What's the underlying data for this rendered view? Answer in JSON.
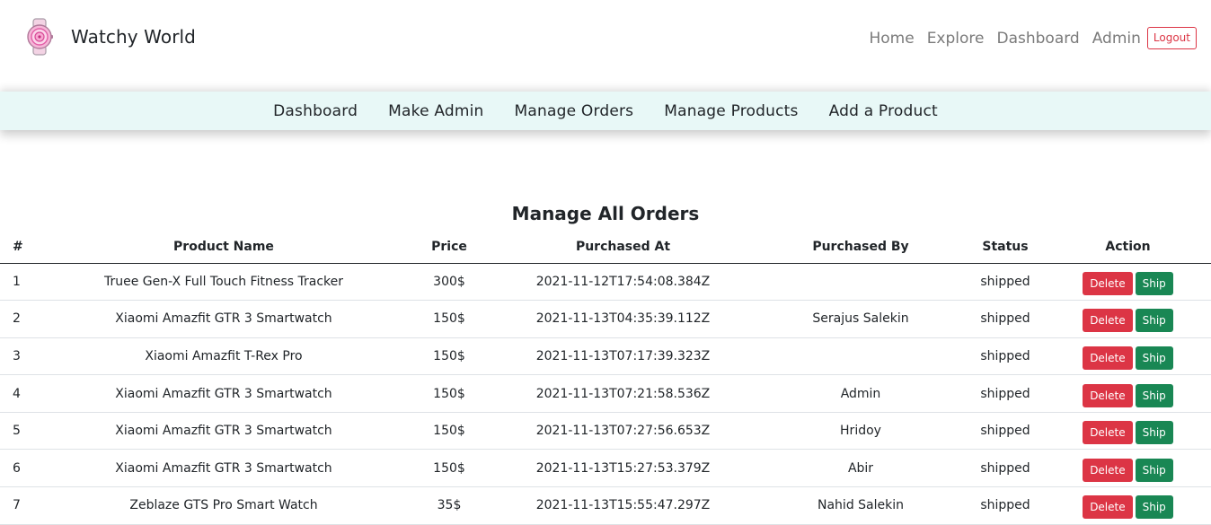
{
  "brand": {
    "name": "Watchy World"
  },
  "topnav": {
    "links": [
      "Home",
      "Explore",
      "Dashboard",
      "Admin"
    ],
    "logout_label": "Logout"
  },
  "subnav": {
    "items": [
      "Dashboard",
      "Make Admin",
      "Manage Orders",
      "Manage Products",
      "Add a Product"
    ]
  },
  "page": {
    "title": "Manage All Orders"
  },
  "table": {
    "headers": [
      "#",
      "Product Name",
      "Price",
      "Purchased At",
      "Purchased By",
      "Status",
      "Action"
    ],
    "delete_label": "Delete",
    "ship_label": "Ship",
    "rows": [
      {
        "num": "1",
        "name": "Truee Gen-X Full Touch Fitness Tracker",
        "price": "300$",
        "date": "2021-11-12T17:54:08.384Z",
        "by": "",
        "status": "shipped"
      },
      {
        "num": "2",
        "name": "Xiaomi Amazfit GTR 3 Smartwatch",
        "price": "150$",
        "date": "2021-11-13T04:35:39.112Z",
        "by": "Serajus Salekin",
        "status": "shipped"
      },
      {
        "num": "3",
        "name": "Xiaomi Amazfit T-Rex Pro",
        "price": "150$",
        "date": "2021-11-13T07:17:39.323Z",
        "by": "",
        "status": "shipped"
      },
      {
        "num": "4",
        "name": "Xiaomi Amazfit GTR 3 Smartwatch",
        "price": "150$",
        "date": "2021-11-13T07:21:58.536Z",
        "by": "Admin",
        "status": "shipped"
      },
      {
        "num": "5",
        "name": "Xiaomi Amazfit GTR 3 Smartwatch",
        "price": "150$",
        "date": "2021-11-13T07:27:56.653Z",
        "by": "Hridoy",
        "status": "shipped"
      },
      {
        "num": "6",
        "name": "Xiaomi Amazfit GTR 3 Smartwatch",
        "price": "150$",
        "date": "2021-11-13T15:27:53.379Z",
        "by": "Abir",
        "status": "shipped"
      },
      {
        "num": "7",
        "name": "Zeblaze GTS Pro Smart Watch",
        "price": "35$",
        "date": "2021-11-13T15:55:47.297Z",
        "by": "Nahid Salekin",
        "status": "shipped"
      }
    ]
  },
  "icons": {
    "brand_logo": "watch-icon"
  },
  "colors": {
    "danger": "#dc3545",
    "success": "#198754",
    "subnav_bg": "#e8f8f7",
    "nav_muted": "#7a7a7a"
  }
}
